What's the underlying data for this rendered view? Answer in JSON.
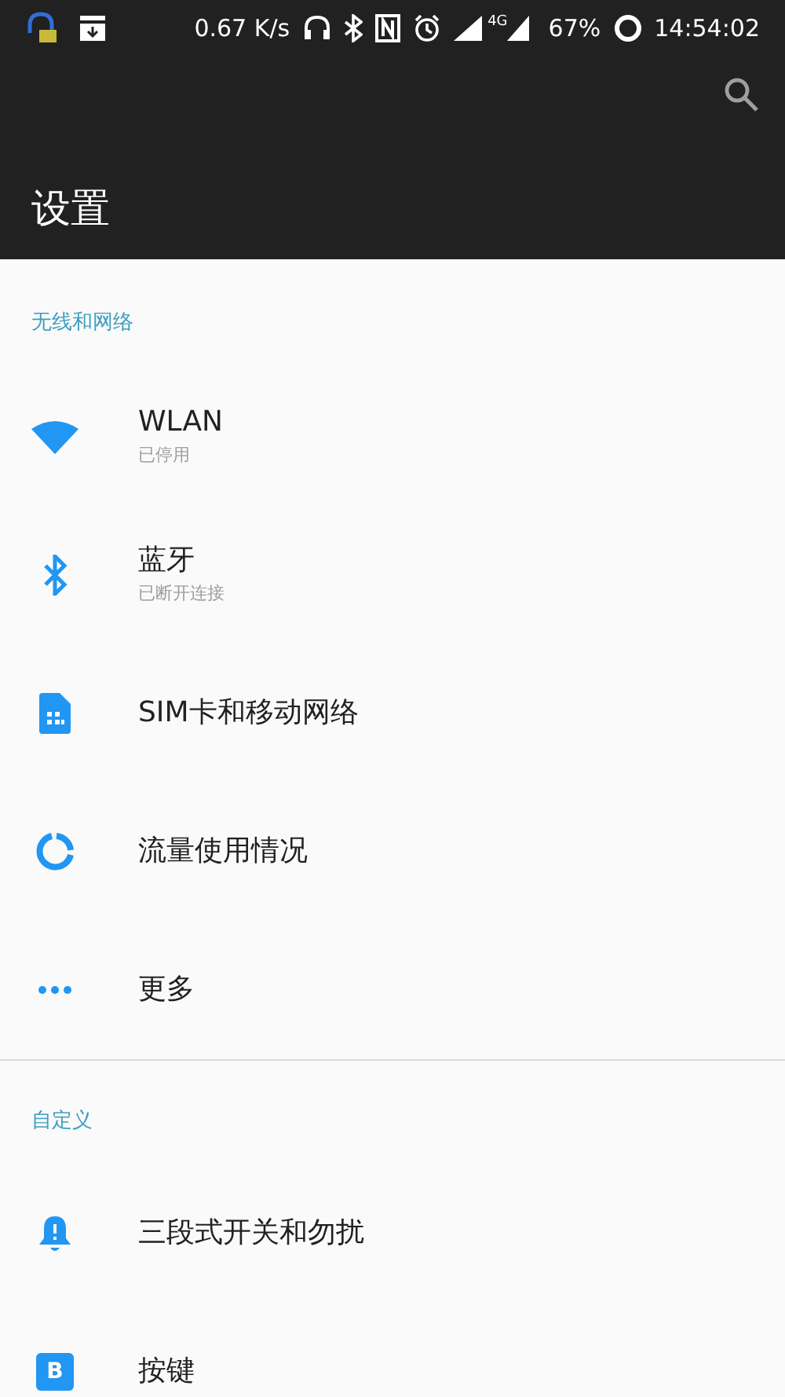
{
  "status_bar": {
    "speed": "0.67 K/s",
    "network": "4G",
    "battery": "67%",
    "time": "14:54:02"
  },
  "toolbar": {
    "title": "设置"
  },
  "sections": [
    {
      "header": "无线和网络",
      "items": [
        {
          "kind": "wifi",
          "title": "WLAN",
          "subtitle": "已停用"
        },
        {
          "kind": "bluetooth",
          "title": "蓝牙",
          "subtitle": "已断开连接"
        },
        {
          "kind": "sim",
          "title": "SIM卡和移动网络"
        },
        {
          "kind": "data",
          "title": "流量使用情况"
        },
        {
          "kind": "more",
          "title": "更多"
        }
      ]
    },
    {
      "header": "自定义",
      "items": [
        {
          "kind": "bell",
          "title": "三段式开关和勿扰"
        },
        {
          "kind": "key",
          "title": "按键",
          "icon_text": "B"
        }
      ]
    }
  ]
}
